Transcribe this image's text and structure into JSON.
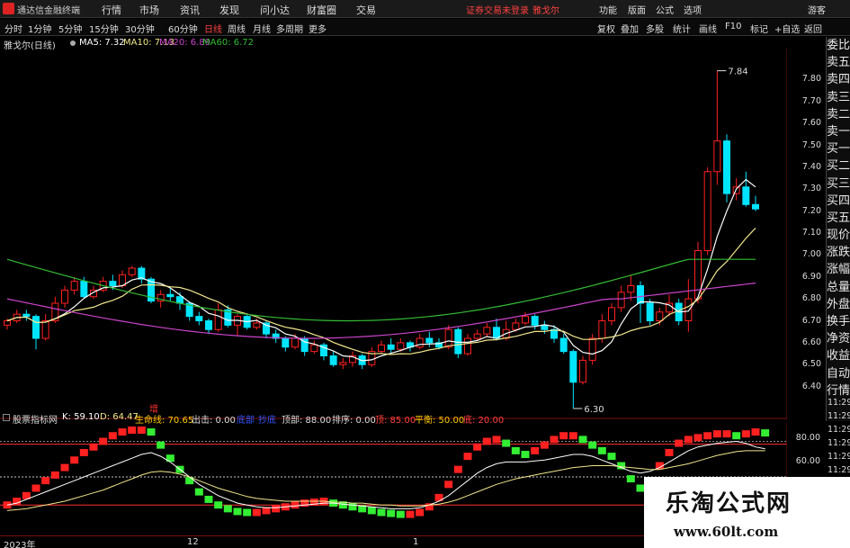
{
  "window": {
    "app_name": "通达信金融终端",
    "menu": [
      "行情",
      "市场",
      "资讯",
      "发现",
      "问小达",
      "财富圈",
      "交易"
    ],
    "trade_status": "证券交易未登录",
    "stock_name": "雅戈尔",
    "right_menu": [
      "功能",
      "版面",
      "公式",
      "选项"
    ],
    "guest_label": "游客"
  },
  "toolbar": {
    "periods": [
      "分时",
      "1分钟",
      "5分钟",
      "15分钟",
      "30分钟",
      "60分钟",
      "日线",
      "周线",
      "月线",
      "多周期",
      "更多"
    ],
    "tools": [
      "复权",
      "叠加",
      "多股",
      "统计",
      "画线",
      "F10",
      "标记",
      "+自选",
      "返回"
    ]
  },
  "legend": {
    "title": "雅戈尔(日线)",
    "ma5": "MA5: 7.32",
    "ma10": "MA10: 7.13",
    "ma20": "MA20: 6.89",
    "ma60": "MA60: 6.72"
  },
  "side_panel": [
    "委比",
    "卖五",
    "卖四",
    "卖三",
    "卖二",
    "卖一",
    "买一",
    "买二",
    "买三",
    "买四",
    "买五",
    "现价",
    "涨跌",
    "涨幅",
    "总量",
    "外盘",
    "换手",
    "净资",
    "收益",
    "自动",
    "行情"
  ],
  "price_axis": [
    "7.80",
    "7.70",
    "7.60",
    "7.50",
    "7.40",
    "7.30",
    "7.20",
    "7.10",
    "7.00",
    "6.90",
    "6.80",
    "6.70",
    "6.60",
    "6.50",
    "6.40"
  ],
  "time_column": [
    "11:29",
    "11:29",
    "11:29",
    "11:29",
    "11:29",
    "11:29",
    "11:29",
    "11:29",
    "11:29",
    "11:29",
    "11:29"
  ],
  "annotations": {
    "high": "7.84",
    "low": "6.30",
    "increase_mark": "增"
  },
  "indicator": {
    "name": "股票指标网",
    "k": "K: 59.10",
    "d": "D: 64.47",
    "life": "生命线: 70.65",
    "out": "出击: 0.00",
    "a1": "底部",
    "a2": "抄底",
    "top": "顶部: 88.00",
    "sort": "排序: 0.00",
    "peak": "顶: 85.00",
    "balance": "平衡: 50.00",
    "low": "底: 20.00",
    "axis": [
      "80.00",
      "60.00"
    ]
  },
  "date_axis": [
    "2023年",
    "12",
    "1"
  ],
  "watermark": {
    "title": "乐淘公式网",
    "url": "www.60lt.com"
  },
  "colors": {
    "up": "#ff2020",
    "down": "#00e5ff",
    "ma5": "#ffffff",
    "ma10": "#f0e68c",
    "ma20": "#cc44cc",
    "ma60": "#33bb33",
    "green_bar": "#33ee33"
  },
  "chart_data": [
    {
      "type": "candlestick",
      "title": "雅戈尔(日线)",
      "ylim": [
        6.3,
        7.9
      ],
      "candles": [
        [
          6.68,
          6.7,
          6.66,
          6.71
        ],
        [
          6.7,
          6.73,
          6.69,
          6.75
        ],
        [
          6.73,
          6.72,
          6.7,
          6.75
        ],
        [
          6.72,
          6.62,
          6.57,
          6.73
        ],
        [
          6.62,
          6.7,
          6.61,
          6.73
        ],
        [
          6.7,
          6.78,
          6.69,
          6.81
        ],
        [
          6.78,
          6.84,
          6.76,
          6.86
        ],
        [
          6.84,
          6.88,
          6.82,
          6.9
        ],
        [
          6.88,
          6.81,
          6.8,
          6.9
        ],
        [
          6.81,
          6.84,
          6.8,
          6.86
        ],
        [
          6.84,
          6.88,
          6.83,
          6.9
        ],
        [
          6.88,
          6.86,
          6.84,
          6.91
        ],
        [
          6.86,
          6.91,
          6.85,
          6.93
        ],
        [
          6.91,
          6.94,
          6.9,
          6.95
        ],
        [
          6.94,
          6.89,
          6.87,
          6.95
        ],
        [
          6.89,
          6.79,
          6.78,
          6.9
        ],
        [
          6.79,
          6.82,
          6.76,
          6.84
        ],
        [
          6.82,
          6.81,
          6.79,
          6.85
        ],
        [
          6.81,
          6.78,
          6.75,
          6.83
        ],
        [
          6.78,
          6.72,
          6.7,
          6.79
        ],
        [
          6.72,
          6.7,
          6.68,
          6.74
        ],
        [
          6.7,
          6.66,
          6.64,
          6.71
        ],
        [
          6.66,
          6.75,
          6.65,
          6.78
        ],
        [
          6.75,
          6.68,
          6.67,
          6.77
        ],
        [
          6.68,
          6.72,
          6.63,
          6.73
        ],
        [
          6.72,
          6.67,
          6.66,
          6.73
        ],
        [
          6.67,
          6.69,
          6.66,
          6.71
        ],
        [
          6.69,
          6.64,
          6.62,
          6.7
        ],
        [
          6.64,
          6.62,
          6.6,
          6.66
        ],
        [
          6.62,
          6.58,
          6.56,
          6.63
        ],
        [
          6.58,
          6.62,
          6.57,
          6.64
        ],
        [
          6.62,
          6.56,
          6.54,
          6.63
        ],
        [
          6.56,
          6.59,
          6.55,
          6.61
        ],
        [
          6.59,
          6.54,
          6.52,
          6.6
        ],
        [
          6.54,
          6.5,
          6.49,
          6.56
        ],
        [
          6.5,
          6.51,
          6.48,
          6.53
        ],
        [
          6.51,
          6.54,
          6.49,
          6.56
        ],
        [
          6.54,
          6.5,
          6.48,
          6.55
        ],
        [
          6.5,
          6.56,
          6.49,
          6.58
        ],
        [
          6.56,
          6.59,
          6.55,
          6.61
        ],
        [
          6.59,
          6.57,
          6.55,
          6.62
        ],
        [
          6.57,
          6.6,
          6.56,
          6.62
        ],
        [
          6.6,
          6.58,
          6.56,
          6.61
        ],
        [
          6.58,
          6.62,
          6.57,
          6.64
        ],
        [
          6.62,
          6.6,
          6.58,
          6.65
        ],
        [
          6.6,
          6.58,
          6.57,
          6.62
        ],
        [
          6.58,
          6.66,
          6.57,
          6.68
        ],
        [
          6.66,
          6.55,
          6.53,
          6.67
        ],
        [
          6.55,
          6.62,
          6.54,
          6.64
        ],
        [
          6.62,
          6.64,
          6.61,
          6.66
        ],
        [
          6.64,
          6.67,
          6.63,
          6.69
        ],
        [
          6.67,
          6.62,
          6.61,
          6.71
        ],
        [
          6.62,
          6.66,
          6.61,
          6.7
        ],
        [
          6.66,
          6.69,
          6.65,
          6.71
        ],
        [
          6.69,
          6.72,
          6.68,
          6.74
        ],
        [
          6.72,
          6.68,
          6.66,
          6.73
        ],
        [
          6.68,
          6.66,
          6.64,
          6.7
        ],
        [
          6.66,
          6.62,
          6.6,
          6.68
        ],
        [
          6.62,
          6.56,
          6.55,
          6.64
        ],
        [
          6.56,
          6.42,
          6.3,
          6.57
        ],
        [
          6.42,
          6.52,
          6.41,
          6.54
        ],
        [
          6.52,
          6.62,
          6.5,
          6.64
        ],
        [
          6.62,
          6.7,
          6.6,
          6.73
        ],
        [
          6.7,
          6.76,
          6.68,
          6.78
        ],
        [
          6.76,
          6.83,
          6.74,
          6.86
        ],
        [
          6.83,
          6.86,
          6.79,
          6.91
        ],
        [
          6.86,
          6.78,
          6.69,
          6.88
        ],
        [
          6.78,
          6.7,
          6.68,
          6.8
        ],
        [
          6.7,
          6.74,
          6.68,
          6.76
        ],
        [
          6.74,
          6.78,
          6.72,
          6.82
        ],
        [
          6.78,
          6.7,
          6.68,
          6.8
        ],
        [
          6.7,
          6.8,
          6.65,
          6.89
        ],
        [
          6.8,
          7.02,
          6.78,
          7.06
        ],
        [
          7.02,
          7.38,
          7.0,
          7.4
        ],
        [
          7.38,
          7.52,
          7.32,
          7.84
        ],
        [
          7.52,
          7.28,
          7.24,
          7.55
        ],
        [
          7.28,
          7.31,
          7.25,
          7.35
        ],
        [
          7.31,
          7.23,
          7.22,
          7.38
        ],
        [
          7.23,
          7.21,
          7.2,
          7.27
        ]
      ]
    },
    {
      "type": "bar",
      "title": "股票指标网",
      "ylim": [
        0,
        100
      ],
      "values": [
        20,
        24,
        30,
        38,
        46,
        52,
        60,
        68,
        76,
        82,
        88,
        94,
        98,
        100,
        100,
        98,
        84,
        70,
        58,
        46,
        34,
        26,
        20,
        16,
        13,
        12,
        12,
        14,
        16,
        18,
        20,
        22,
        23,
        24,
        22,
        20,
        18,
        16,
        14,
        12,
        11,
        10,
        10,
        12,
        18,
        28,
        42,
        58,
        72,
        82,
        88,
        90,
        86,
        78,
        74,
        78,
        84,
        90,
        94,
        94,
        90,
        84,
        78,
        72,
        62,
        48,
        38,
        46,
        62,
        76,
        86,
        90,
        92,
        94,
        96,
        96,
        94,
        96,
        98,
        97
      ],
      "series": [
        {
          "name": "K",
          "values": [
            20,
            22,
            26,
            30,
            34,
            38,
            42,
            46,
            50,
            54,
            58,
            62,
            66,
            70,
            74,
            76,
            72,
            66,
            58,
            50,
            42,
            36,
            30,
            26,
            22,
            20,
            18,
            17,
            17,
            18,
            19,
            20,
            21,
            22,
            22,
            21,
            20,
            19,
            18,
            17,
            16,
            16,
            16,
            17,
            20,
            24,
            30,
            38,
            46,
            54,
            60,
            64,
            66,
            66,
            66,
            67,
            68,
            70,
            72,
            74,
            74,
            72,
            68,
            64,
            60,
            56,
            54,
            56,
            60,
            66,
            72,
            78,
            82,
            84,
            86,
            87,
            88,
            86,
            82,
            80
          ]
        },
        {
          "name": "D",
          "values": [
            14,
            15,
            16,
            18,
            20,
            22,
            24,
            27,
            30,
            33,
            36,
            40,
            44,
            48,
            52,
            55,
            56,
            55,
            53,
            50,
            46,
            42,
            38,
            35,
            32,
            29,
            27,
            26,
            25,
            24,
            24,
            24,
            24,
            24,
            23,
            23,
            22,
            22,
            21,
            20,
            20,
            19,
            19,
            19,
            20,
            21,
            23,
            26,
            30,
            34,
            38,
            42,
            45,
            48,
            50,
            52,
            54,
            56,
            58,
            60,
            61,
            62,
            62,
            62,
            61,
            60,
            59,
            58,
            58,
            60,
            62,
            64,
            67,
            70,
            73,
            75,
            77,
            78,
            78,
            78
          ]
        }
      ]
    }
  ]
}
